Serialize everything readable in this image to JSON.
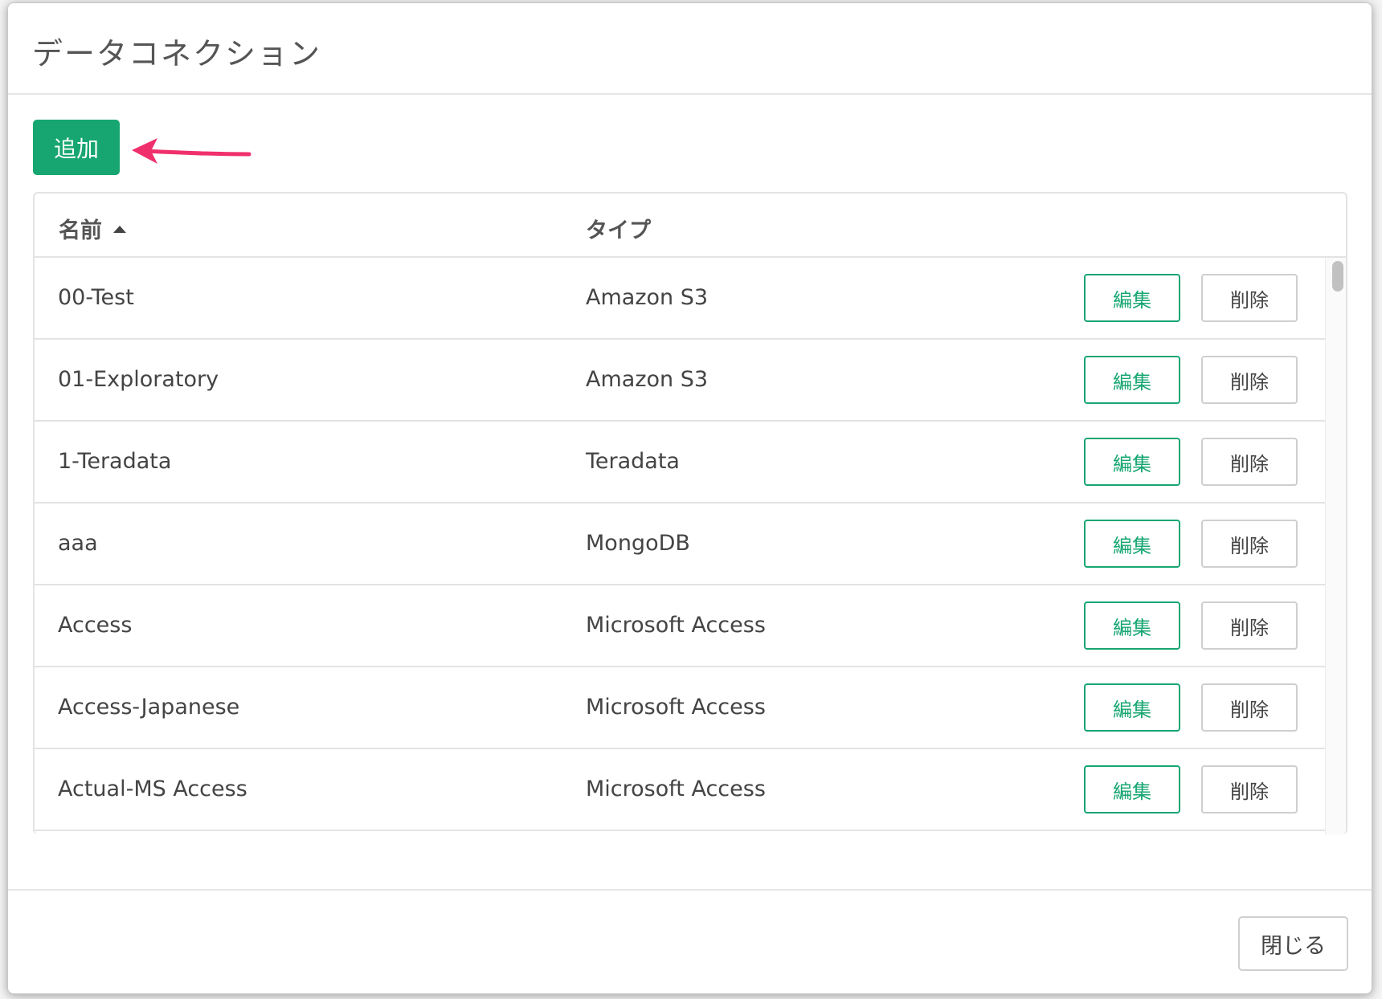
{
  "dialog": {
    "title": "データコネクション",
    "add_label": "追加",
    "close_label": "閉じる"
  },
  "table": {
    "columns": {
      "name": "名前",
      "type": "タイプ"
    },
    "sort": {
      "column": "name",
      "direction": "ascending"
    },
    "edit_label": "編集",
    "delete_label": "削除",
    "rows": [
      {
        "name": "00-Test",
        "type": "Amazon S3"
      },
      {
        "name": "01-Exploratory",
        "type": "Amazon S3"
      },
      {
        "name": "1-Teradata",
        "type": "Teradata"
      },
      {
        "name": "aaa",
        "type": "MongoDB"
      },
      {
        "name": "Access",
        "type": "Microsoft Access"
      },
      {
        "name": "Access-Japanese",
        "type": "Microsoft Access"
      },
      {
        "name": "Actual-MS Access",
        "type": "Microsoft Access"
      }
    ]
  },
  "colors": {
    "primary": "#17a672",
    "annotation_arrow": "#f0306c"
  },
  "icons": {
    "sort": "sort-ascending-icon",
    "annotation": "arrow-left-annotation-icon"
  }
}
